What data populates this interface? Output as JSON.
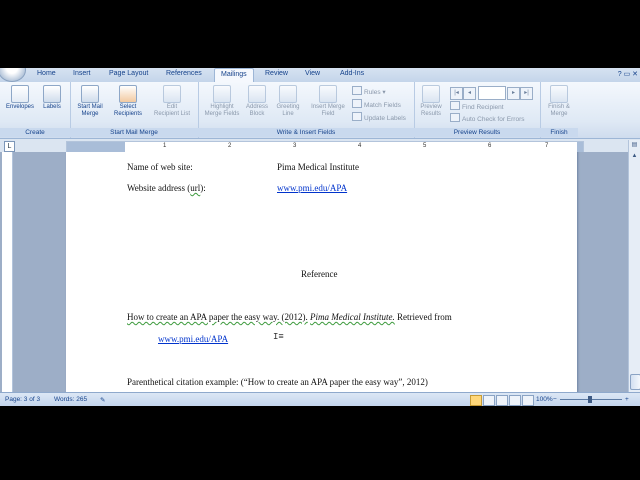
{
  "tabs": [
    "Home",
    "Insert",
    "Page Layout",
    "References",
    "Mailings",
    "Review",
    "View",
    "Add-Ins"
  ],
  "active_tab": "Mailings",
  "ribbon": {
    "groups": {
      "create": "Create",
      "start_mail_merge": "Start Mail Merge",
      "write_insert_fields": "Write & Insert Fields",
      "preview_results": "Preview Results",
      "finish": "Finish"
    },
    "envelopes": "Envelopes",
    "labels": "Labels",
    "start_mail_merge": [
      "Start Mail",
      "Merge"
    ],
    "select_recipients": [
      "Select",
      "Recipients"
    ],
    "edit_recipient_list": [
      "Edit",
      "Recipient List"
    ],
    "highlight_merge_fields": [
      "Highlight",
      "Merge Fields"
    ],
    "address_block": [
      "Address",
      "Block"
    ],
    "greeting_line": [
      "Greeting",
      "Line"
    ],
    "insert_merge_field": [
      "Insert Merge",
      "Field"
    ],
    "rules": "Rules",
    "match_fields": "Match Fields",
    "update_labels": "Update Labels",
    "preview_results": [
      "Preview",
      "Results"
    ],
    "find_recipient": "Find Recipient",
    "auto_check_errors": "Auto Check for Errors",
    "finish_merge": [
      "Finish &",
      "Merge"
    ]
  },
  "ruler_numbers": [
    "1",
    "2",
    "3",
    "4",
    "5",
    "6",
    "7"
  ],
  "document": {
    "website_name_label": "Name of web site:",
    "website_name_value": "Pima Medical Institute",
    "website_address_label_pre": "Website address (",
    "website_address_label_url": "url",
    "website_address_label_post": "):",
    "website_address_value": "www.pmi.edu/APA",
    "reference_heading": "Reference",
    "ref_title": "How to create an APA paper the easy way. (2012).",
    "ref_publisher": "Pima Medical Institute.",
    "ref_retrieved": "Retrieved from",
    "ref_url": "www.pmi.edu/APA",
    "citation_example": "Parenthetical citation example:  (“How to create an APA paper the easy way”, 2012)"
  },
  "status": {
    "page": "Page: 3 of 3",
    "words": "Words: 265",
    "zoom": "100%"
  }
}
